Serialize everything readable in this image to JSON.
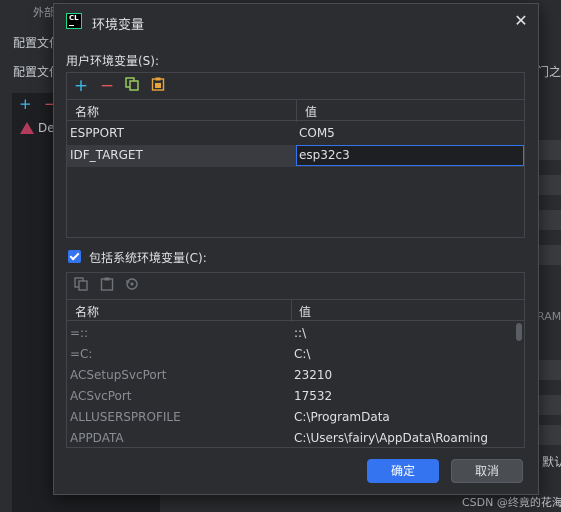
{
  "background": {
    "top_label": "外部",
    "row1": "配置文件",
    "row2": "配置文件",
    "tree_item": "De",
    "right_text1": "门之间",
    "right_text2": "RAM=",
    "right_text3": "默认",
    "footer": "CSDN @终竟的花海"
  },
  "dialog": {
    "app_icon_text": "CL",
    "title": "环境变量",
    "user_section_label": "用户环境变量(S):",
    "user_table": {
      "col_name": "名称",
      "col_value": "值",
      "rows": [
        {
          "name": "ESPPORT",
          "value": "COM5"
        },
        {
          "name": "IDF_TARGET",
          "value": "esp32c3"
        }
      ]
    },
    "include_system_label": "包括系统环境变量(C):",
    "system_table": {
      "col_name": "名称",
      "col_value": "值",
      "rows": [
        {
          "name": "=::",
          "value": "::\\"
        },
        {
          "name": "=C:",
          "value": "C:\\"
        },
        {
          "name": "ACSetupSvcPort",
          "value": "23210"
        },
        {
          "name": "ACSvcPort",
          "value": "17532"
        },
        {
          "name": "ALLUSERSPROFILE",
          "value": "C:\\ProgramData"
        },
        {
          "name": "APPDATA",
          "value": "C:\\Users\\fairy\\AppData\\Roaming"
        }
      ]
    },
    "ok_label": "确定",
    "cancel_label": "取消"
  },
  "colors": {
    "accent": "#3574f0",
    "add_icon": "#3fb6e8",
    "remove_icon": "#e0565b",
    "paste_icon": "#e8a33d"
  }
}
